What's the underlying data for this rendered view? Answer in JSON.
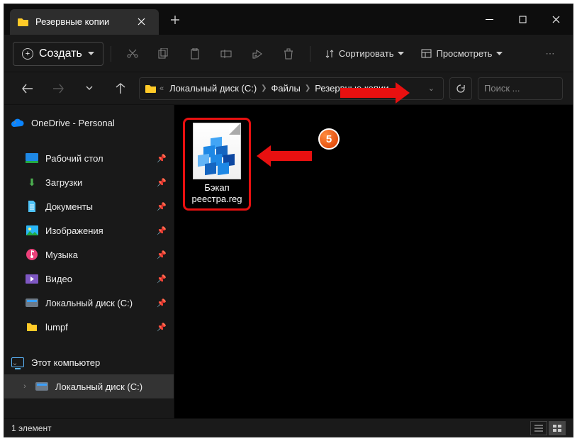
{
  "tab": {
    "title": "Резервные копии"
  },
  "toolbar": {
    "new_label": "Создать",
    "sort_label": "Сортировать",
    "view_label": "Просмотреть"
  },
  "breadcrumb": {
    "segments": [
      "Локальный диск (C:)",
      "Файлы",
      "Резервные копии"
    ]
  },
  "search": {
    "placeholder": "Поиск ..."
  },
  "sidebar": {
    "onedrive": "OneDrive - Personal",
    "quick": [
      {
        "label": "Рабочий стол",
        "icon": "desktop"
      },
      {
        "label": "Загрузки",
        "icon": "downloads"
      },
      {
        "label": "Документы",
        "icon": "documents"
      },
      {
        "label": "Изображения",
        "icon": "pictures"
      },
      {
        "label": "Музыка",
        "icon": "music"
      },
      {
        "label": "Видео",
        "icon": "video"
      },
      {
        "label": "Локальный диск (C:)",
        "icon": "disk"
      },
      {
        "label": "lumpf",
        "icon": "folder"
      }
    ],
    "this_pc": "Этот компьютер",
    "disk": "Локальный диск (C:)"
  },
  "file": {
    "name_l1": "Бэкап",
    "name_l2": "реестра.reg"
  },
  "status": {
    "count": "1 элемент"
  },
  "annotation": {
    "step": "5"
  }
}
